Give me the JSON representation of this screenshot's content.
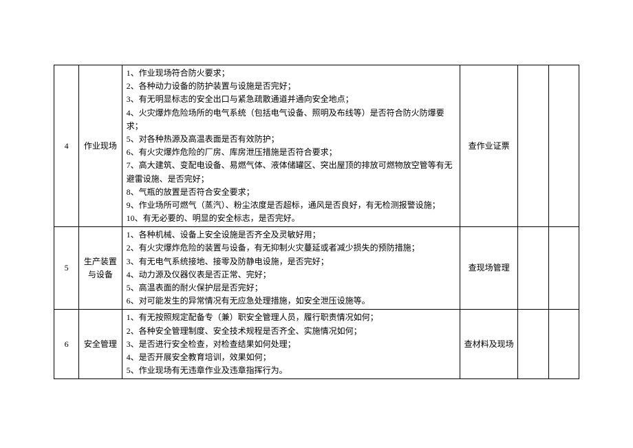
{
  "rows": [
    {
      "num": "4",
      "category": "作业现场",
      "method": "查作业证票",
      "items": [
        "1、作业现场符合防火要求；",
        "2、各种动力设备的防护装置与设施是否完好；",
        "3、有无明显标志的安全出口与紧急疏散通道并通向安全地点；",
        "4、火灾爆炸危险场所的电气系统（包括电气设备、照明及布线等）是否符合防火防爆要求；",
        "5、对各种热源及高温表面是否有效防护；",
        "6、有火灾爆炸危险的厂房、库房泄压措施是否符合要求；",
        "7、高大建筑、变配电设备、易燃气体、液体储罐区、突出屋顶的排放可燃物放空管等有无避雷设施、是否完好；",
        "8、气瓶的放置是否符合安全要求；",
        "9、作业场所可燃气（蒸汽）、粉尘浓度是否超标，通风是否良好，有无检测报警设施；",
        "10、有无必要的、明显的安全标志，是否完好。"
      ]
    },
    {
      "num": "5",
      "category": "生产装置与设备",
      "method": "查现场管理",
      "items": [
        "1、各种机械、设备上安全设施是否齐全及灵敏好用；",
        "2、有火灾爆炸危险的装置与设备，有无抑制火灾蔓延或者减少损失的预防措施；",
        "3、有无电气系统接地、接零及防静电设施，是否完好；",
        "4、动力源及仪器仪表是否正常、完好；",
        "5、高温表面的耐火保护层是否完好；",
        "6、对可能发生的异常情况有无应急处理措施，如安全泄压设施等。"
      ]
    },
    {
      "num": "6",
      "category": "安全管理",
      "method": "查材料及现场",
      "items": [
        "1、有无按照规定配备专（兼）职安全管理人员，履行职责情况如何；",
        "2、各种安全管理制度、安全技术规程是否齐全、实施情况如何；",
        "3、是否进行安全检查，对检查结果如何处理；",
        "4、是否开展安全教育培训，效果如何；",
        "5、作业现场有无违章作业及违章指挥行为。"
      ]
    }
  ]
}
